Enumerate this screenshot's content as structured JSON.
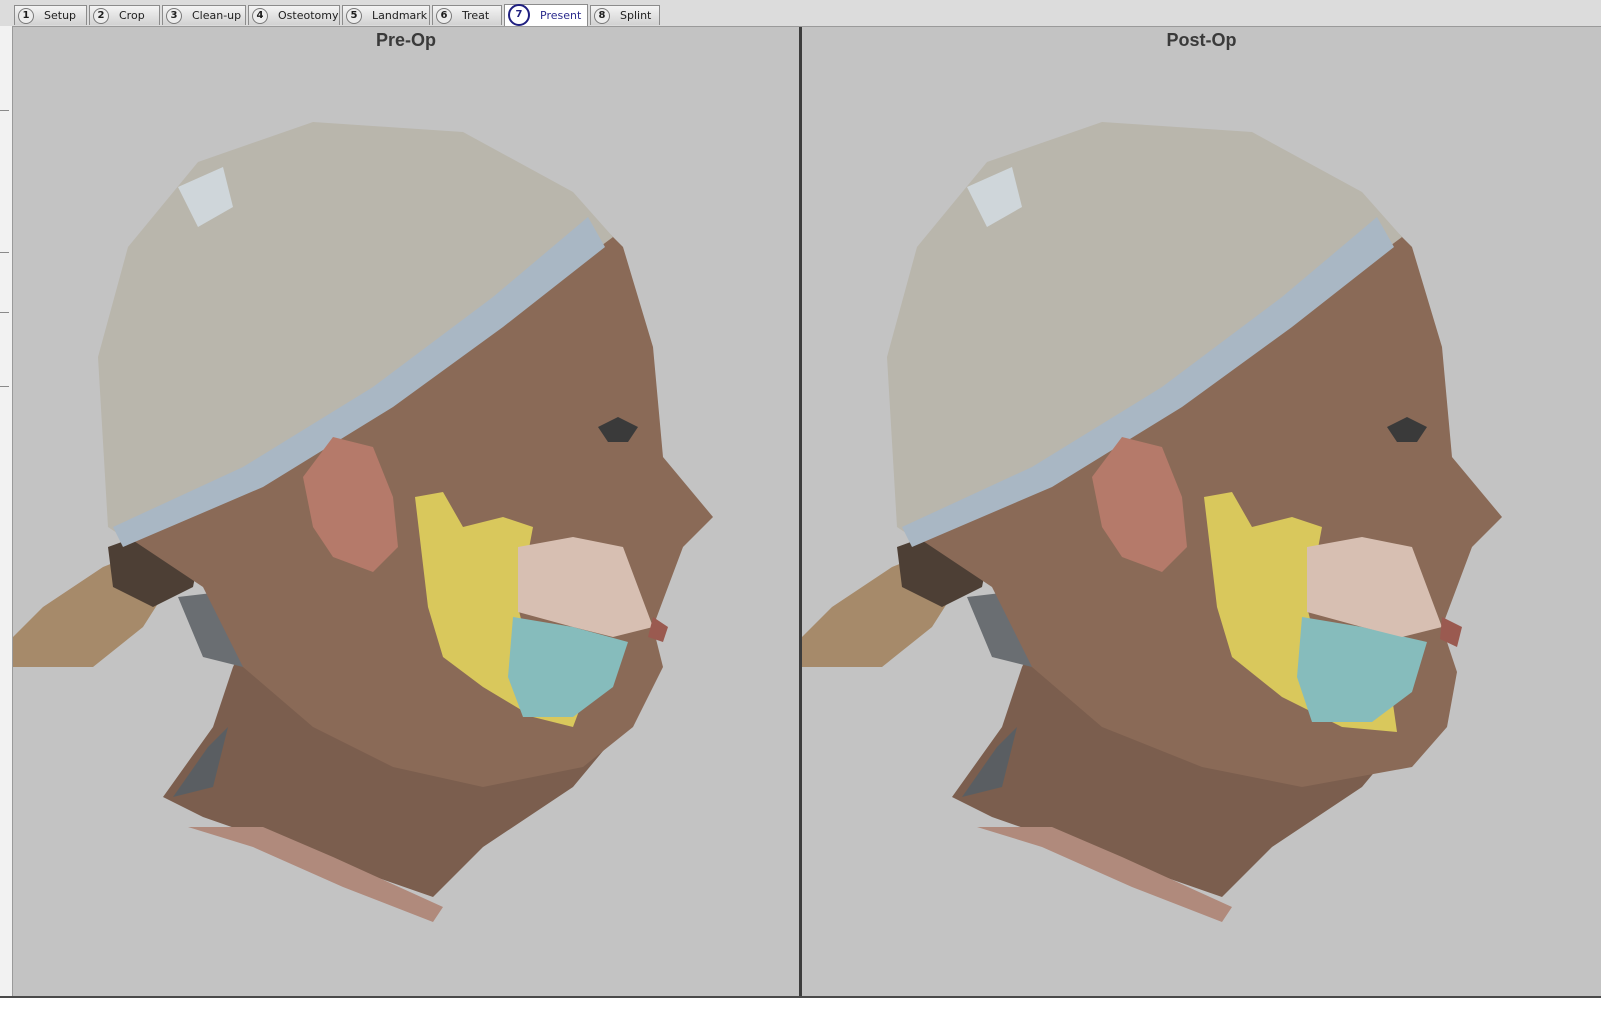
{
  "tabs": [
    {
      "num": "1",
      "label": "Setup"
    },
    {
      "num": "2",
      "label": "Crop"
    },
    {
      "num": "3",
      "label": "Clean-up"
    },
    {
      "num": "4",
      "label": "Osteotomy"
    },
    {
      "num": "5",
      "label": "Landmark"
    },
    {
      "num": "6",
      "label": "Treat"
    },
    {
      "num": "7",
      "label": "Present",
      "active": true
    },
    {
      "num": "8",
      "label": "Splint"
    }
  ],
  "viewports": {
    "pre": {
      "title": "Pre-Op"
    },
    "post": {
      "title": "Post-Op"
    }
  },
  "colors": {
    "viewport_bg": "#c3c3c3",
    "skin": "#8a6a57",
    "cap": "#b9b6ac",
    "band": "#a9b7c4",
    "mandible": "#d9c85c",
    "lower_teeth": "#86bcbc",
    "upper_teeth": "#d7bfb2",
    "ear": "#b57a6a",
    "hair": "#a68a6a"
  }
}
